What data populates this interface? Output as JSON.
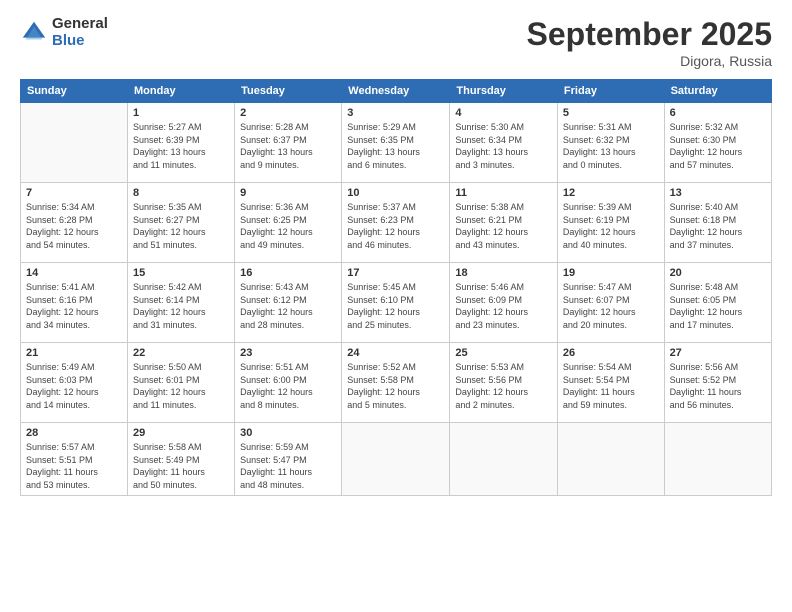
{
  "logo": {
    "general": "General",
    "blue": "Blue"
  },
  "title": "September 2025",
  "location": "Digora, Russia",
  "days_of_week": [
    "Sunday",
    "Monday",
    "Tuesday",
    "Wednesday",
    "Thursday",
    "Friday",
    "Saturday"
  ],
  "weeks": [
    [
      {
        "day": "",
        "info": ""
      },
      {
        "day": "1",
        "info": "Sunrise: 5:27 AM\nSunset: 6:39 PM\nDaylight: 13 hours\nand 11 minutes."
      },
      {
        "day": "2",
        "info": "Sunrise: 5:28 AM\nSunset: 6:37 PM\nDaylight: 13 hours\nand 9 minutes."
      },
      {
        "day": "3",
        "info": "Sunrise: 5:29 AM\nSunset: 6:35 PM\nDaylight: 13 hours\nand 6 minutes."
      },
      {
        "day": "4",
        "info": "Sunrise: 5:30 AM\nSunset: 6:34 PM\nDaylight: 13 hours\nand 3 minutes."
      },
      {
        "day": "5",
        "info": "Sunrise: 5:31 AM\nSunset: 6:32 PM\nDaylight: 13 hours\nand 0 minutes."
      },
      {
        "day": "6",
        "info": "Sunrise: 5:32 AM\nSunset: 6:30 PM\nDaylight: 12 hours\nand 57 minutes."
      }
    ],
    [
      {
        "day": "7",
        "info": "Sunrise: 5:34 AM\nSunset: 6:28 PM\nDaylight: 12 hours\nand 54 minutes."
      },
      {
        "day": "8",
        "info": "Sunrise: 5:35 AM\nSunset: 6:27 PM\nDaylight: 12 hours\nand 51 minutes."
      },
      {
        "day": "9",
        "info": "Sunrise: 5:36 AM\nSunset: 6:25 PM\nDaylight: 12 hours\nand 49 minutes."
      },
      {
        "day": "10",
        "info": "Sunrise: 5:37 AM\nSunset: 6:23 PM\nDaylight: 12 hours\nand 46 minutes."
      },
      {
        "day": "11",
        "info": "Sunrise: 5:38 AM\nSunset: 6:21 PM\nDaylight: 12 hours\nand 43 minutes."
      },
      {
        "day": "12",
        "info": "Sunrise: 5:39 AM\nSunset: 6:19 PM\nDaylight: 12 hours\nand 40 minutes."
      },
      {
        "day": "13",
        "info": "Sunrise: 5:40 AM\nSunset: 6:18 PM\nDaylight: 12 hours\nand 37 minutes."
      }
    ],
    [
      {
        "day": "14",
        "info": "Sunrise: 5:41 AM\nSunset: 6:16 PM\nDaylight: 12 hours\nand 34 minutes."
      },
      {
        "day": "15",
        "info": "Sunrise: 5:42 AM\nSunset: 6:14 PM\nDaylight: 12 hours\nand 31 minutes."
      },
      {
        "day": "16",
        "info": "Sunrise: 5:43 AM\nSunset: 6:12 PM\nDaylight: 12 hours\nand 28 minutes."
      },
      {
        "day": "17",
        "info": "Sunrise: 5:45 AM\nSunset: 6:10 PM\nDaylight: 12 hours\nand 25 minutes."
      },
      {
        "day": "18",
        "info": "Sunrise: 5:46 AM\nSunset: 6:09 PM\nDaylight: 12 hours\nand 23 minutes."
      },
      {
        "day": "19",
        "info": "Sunrise: 5:47 AM\nSunset: 6:07 PM\nDaylight: 12 hours\nand 20 minutes."
      },
      {
        "day": "20",
        "info": "Sunrise: 5:48 AM\nSunset: 6:05 PM\nDaylight: 12 hours\nand 17 minutes."
      }
    ],
    [
      {
        "day": "21",
        "info": "Sunrise: 5:49 AM\nSunset: 6:03 PM\nDaylight: 12 hours\nand 14 minutes."
      },
      {
        "day": "22",
        "info": "Sunrise: 5:50 AM\nSunset: 6:01 PM\nDaylight: 12 hours\nand 11 minutes."
      },
      {
        "day": "23",
        "info": "Sunrise: 5:51 AM\nSunset: 6:00 PM\nDaylight: 12 hours\nand 8 minutes."
      },
      {
        "day": "24",
        "info": "Sunrise: 5:52 AM\nSunset: 5:58 PM\nDaylight: 12 hours\nand 5 minutes."
      },
      {
        "day": "25",
        "info": "Sunrise: 5:53 AM\nSunset: 5:56 PM\nDaylight: 12 hours\nand 2 minutes."
      },
      {
        "day": "26",
        "info": "Sunrise: 5:54 AM\nSunset: 5:54 PM\nDaylight: 11 hours\nand 59 minutes."
      },
      {
        "day": "27",
        "info": "Sunrise: 5:56 AM\nSunset: 5:52 PM\nDaylight: 11 hours\nand 56 minutes."
      }
    ],
    [
      {
        "day": "28",
        "info": "Sunrise: 5:57 AM\nSunset: 5:51 PM\nDaylight: 11 hours\nand 53 minutes."
      },
      {
        "day": "29",
        "info": "Sunrise: 5:58 AM\nSunset: 5:49 PM\nDaylight: 11 hours\nand 50 minutes."
      },
      {
        "day": "30",
        "info": "Sunrise: 5:59 AM\nSunset: 5:47 PM\nDaylight: 11 hours\nand 48 minutes."
      },
      {
        "day": "",
        "info": ""
      },
      {
        "day": "",
        "info": ""
      },
      {
        "day": "",
        "info": ""
      },
      {
        "day": "",
        "info": ""
      }
    ]
  ]
}
